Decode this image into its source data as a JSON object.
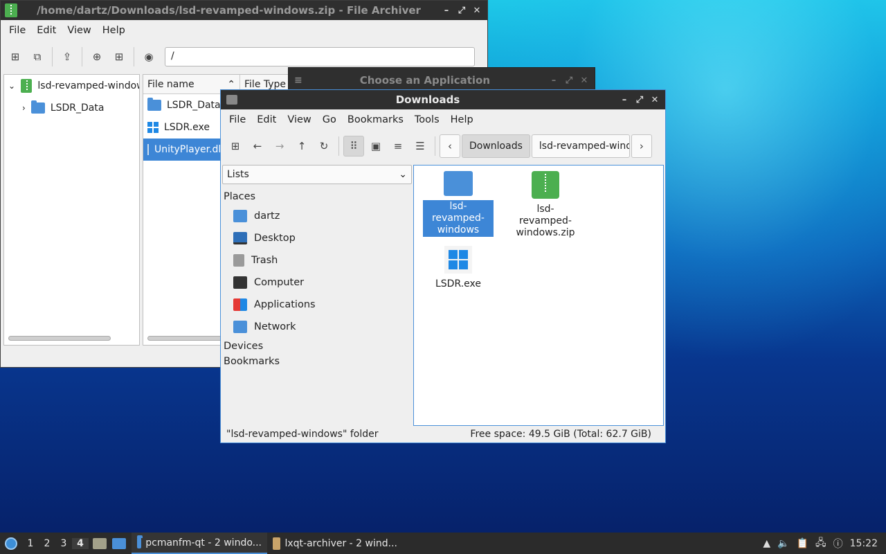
{
  "archiver": {
    "title": "/home/dartz/Downloads/lsd-revamped-windows.zip - File Archiver",
    "menu": [
      "File",
      "Edit",
      "View",
      "Help"
    ],
    "path": "/",
    "tree_root": "lsd-revamped-windows",
    "tree_child": "LSDR_Data",
    "columns": [
      "File name",
      "File Type"
    ],
    "files": [
      "LSDR_Data",
      "LSDR.exe",
      "UnityPlayer.dll"
    ]
  },
  "choose_app": {
    "title": "Choose an Application"
  },
  "downloads": {
    "title": "Downloads",
    "menu": [
      "File",
      "Edit",
      "View",
      "Go",
      "Bookmarks",
      "Tools",
      "Help"
    ],
    "breadcrumbs": [
      "Downloads",
      "lsd-revamped-windows"
    ],
    "side_view": "Lists",
    "places_header": "Places",
    "places": [
      "dartz",
      "Desktop",
      "Trash",
      "Computer",
      "Applications",
      "Network"
    ],
    "devices_header": "Devices",
    "bookmarks_header": "Bookmarks",
    "items": [
      "lsd-revamped-windows",
      "lsd-revamped-windows.zip",
      "LSDR.exe"
    ],
    "status_left": "\"lsd-revamped-windows\" folder",
    "status_right": "Free space: 49.5 GiB (Total: 62.7 GiB)"
  },
  "taskbar": {
    "workspaces": [
      "1",
      "2",
      "3",
      "4"
    ],
    "tasks": [
      "pcmanfm-qt - 2 windo...",
      "lxqt-archiver - 2 wind..."
    ],
    "clock": "15:22"
  }
}
